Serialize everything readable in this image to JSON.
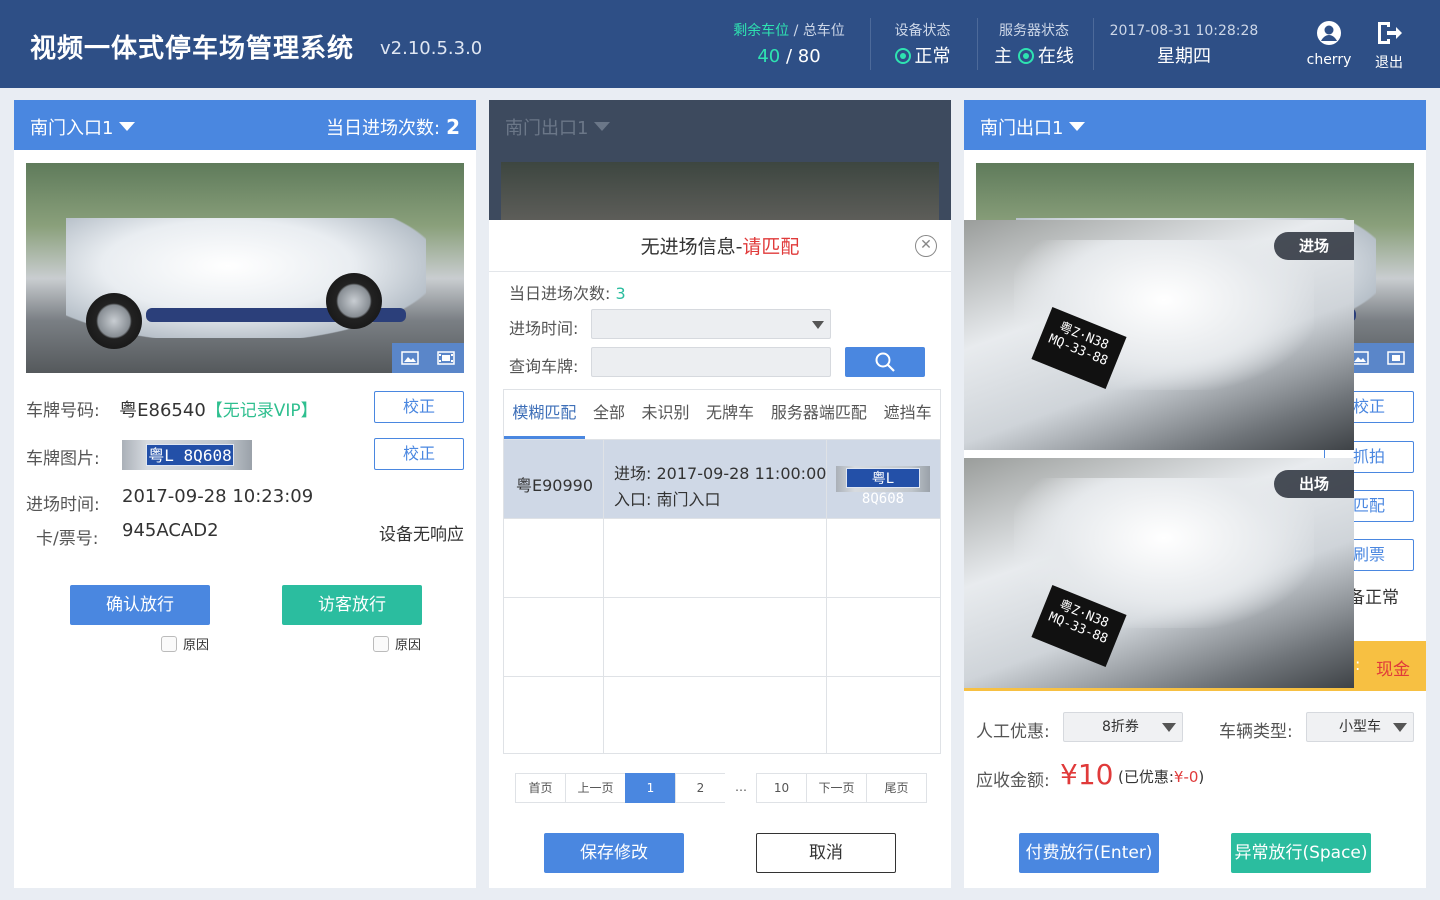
{
  "header": {
    "title": "视频一体式停车场管理系统",
    "version": "v2.10.5.3.0",
    "spaces_label_remaining": "剩余车位",
    "spaces_label_slash": " / ",
    "spaces_label_total": "总车位",
    "spaces_remaining": "40",
    "spaces_sep": " / ",
    "spaces_total": "80",
    "device_status_label": "设备状态",
    "device_status_value": "正常",
    "service_status_label": "服务器状态",
    "service_status_prefix": "主",
    "service_status_value": "在线",
    "datetime": "2017-08-31 10:28:28",
    "weekday": "星期四",
    "user": "cherry",
    "logout": "退出",
    "status_color": "#2ee3b1"
  },
  "left_panel": {
    "name": "南门入口1",
    "count_label": "当日进场次数:",
    "count_value": "2",
    "plate_label": "车牌号码:",
    "plate_value": "粤E86540",
    "plate_tag": "【无记录VIP】",
    "plate_correct": "校正",
    "plate_img_label": "车牌图片:",
    "plate_img_text": "粤L 8Q608",
    "plate_img_correct": "校正",
    "entry_time_label": "进场时间:",
    "entry_time_value": "2017-09-28 10:23:09",
    "card_label": "卡/票号:",
    "card_value": "945ACAD2",
    "device_msg": "设备无响应",
    "confirm_btn": "确认放行",
    "visitor_btn": "访客放行",
    "reason1": "原因",
    "reason2": "原因"
  },
  "middle_panel": {
    "name": "南门出口1"
  },
  "modal": {
    "title_main": "无进场信息-",
    "title_red": "请匹配",
    "today_label": "当日进场次数:",
    "today_value": "3",
    "entry_time_label": "进场时间:",
    "plate_query_label": "查询车牌:",
    "plate_query_value": "",
    "tabs": [
      "模糊匹配",
      "全部",
      "未识别",
      "无牌车",
      "服务器端匹配",
      "遮挡车"
    ],
    "row": {
      "plate": "粤E90990",
      "entry_label": "进场:",
      "entry_value": "2017-09-28 11:00:00",
      "gate_label": "入口:",
      "gate_value": "南门入口",
      "plate_img_text": "粤L 8Q608"
    },
    "pager": [
      "首页",
      "上一页",
      "1",
      "2",
      "…",
      "10",
      "下一页",
      "尾页"
    ],
    "save_btn": "保存修改",
    "cancel_btn": "取消"
  },
  "right_panel": {
    "name": "南门出口1",
    "entry_tag": "进场",
    "exit_tag": "出场",
    "overlay_plate": "粤Z·N38 MQ-33-88",
    "btn_correct": "校正",
    "btn_capture": "抓拍",
    "btn_match": "匹配",
    "btn_ticket": "刷票",
    "device_ok": "备正常",
    "payment_sep": ":",
    "payment_method": "现金",
    "discount_label": "人工优惠:",
    "discount_value": "8折券",
    "vehicle_type_label": "车辆类型:",
    "vehicle_type_value": "小型车",
    "amount_label": "应收金额:",
    "amount_value": "¥10",
    "discounted_prefix": "(已优惠:",
    "discounted_value": "¥-0",
    "discounted_suffix": ")",
    "pay_btn": "付费放行(Enter)",
    "abnormal_btn": "异常放行(Space)"
  },
  "colors": {
    "header_bg": "#2e4f86",
    "panel_head": "#4a87e0",
    "blue_btn": "#4a87e0",
    "teal_btn": "#2bbd9f",
    "accent_red": "#e03a3a",
    "orange_bar": "#f7c042"
  }
}
